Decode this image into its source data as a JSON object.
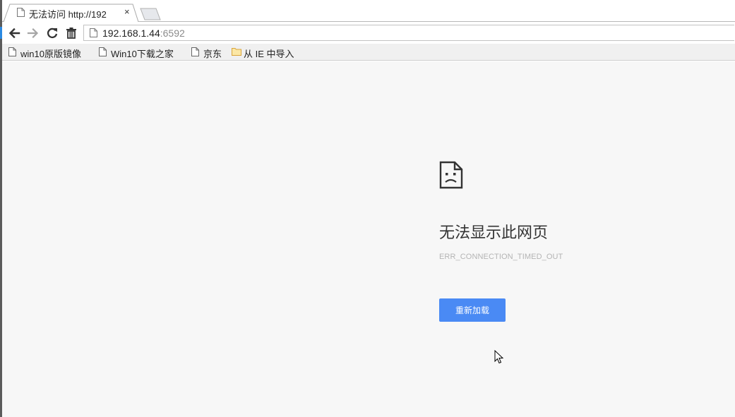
{
  "tabs": [
    {
      "title": "无法访问 http://192",
      "close": "×",
      "icon": "page-icon"
    }
  ],
  "toolbar": {
    "back_icon": "arrow-left-icon",
    "forward_icon": "arrow-right-icon",
    "reload_icon": "reload-icon",
    "trash_icon": "trash-icon"
  },
  "address": {
    "host": "192.168.1.44",
    "port": ":6592",
    "icon": "page-icon"
  },
  "bookmarks": [
    {
      "label": "win10原版镜像",
      "icon": "page-icon"
    },
    {
      "label": "Win10下载之家",
      "icon": "page-icon"
    },
    {
      "label": "京东",
      "icon": "page-icon"
    },
    {
      "label": "从 IE 中导入",
      "icon": "folder-icon"
    }
  ],
  "error": {
    "icon": "sad-page-icon",
    "title": "无法显示此网页",
    "code": "ERR_CONNECTION_TIMED_OUT",
    "reload_label": "重新加载"
  },
  "colors": {
    "accent": "#4a8af4",
    "page_bg": "#f7f7f7",
    "folder": "#e8b64a"
  }
}
